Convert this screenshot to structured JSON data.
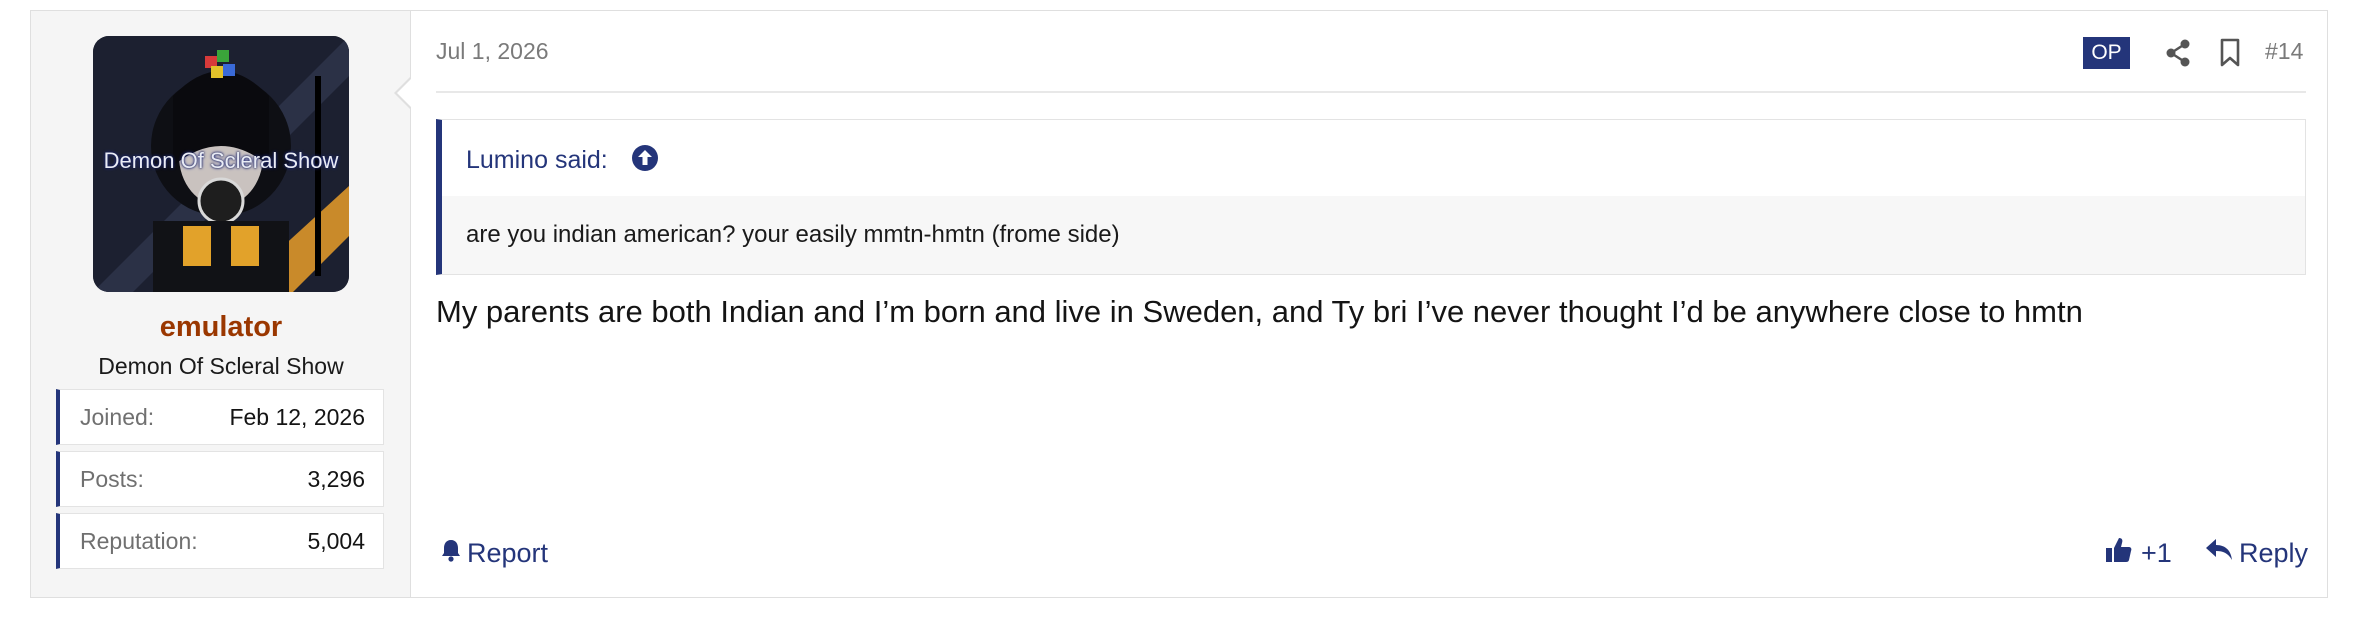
{
  "user": {
    "avatar_caption": "Demon Of Scleral Show",
    "username": "emulator",
    "title": "Demon Of Scleral Show",
    "stats": [
      {
        "label": "Joined:",
        "value": "Feb 12, 2026"
      },
      {
        "label": "Posts:",
        "value": "3,296"
      },
      {
        "label": "Reputation:",
        "value": "5,004"
      }
    ]
  },
  "post": {
    "date": "Jul 1, 2026",
    "op_badge": "OP",
    "number": "#14",
    "quote": {
      "author_line": "Lumino said:",
      "text": "are you indian american? your easily mmtn-hmtn (frome side)"
    },
    "message": "My parents are both Indian and I’m born and live in Sweden, and Ty bri I’ve never thought I’d be anywhere close to hmtn"
  },
  "actions": {
    "report_label": "Report",
    "like_count": "+1",
    "reply_label": "Reply"
  },
  "icons": {
    "share": "share-icon",
    "bookmark": "bookmark-icon",
    "quote_jump": "arrow-up-circle-icon",
    "report": "bell-icon",
    "like": "thumbs-up-icon",
    "reply": "reply-icon"
  },
  "colors": {
    "accent": "#24357a",
    "username": "#9a3700",
    "user_panel_bg": "#f5f5f5"
  }
}
